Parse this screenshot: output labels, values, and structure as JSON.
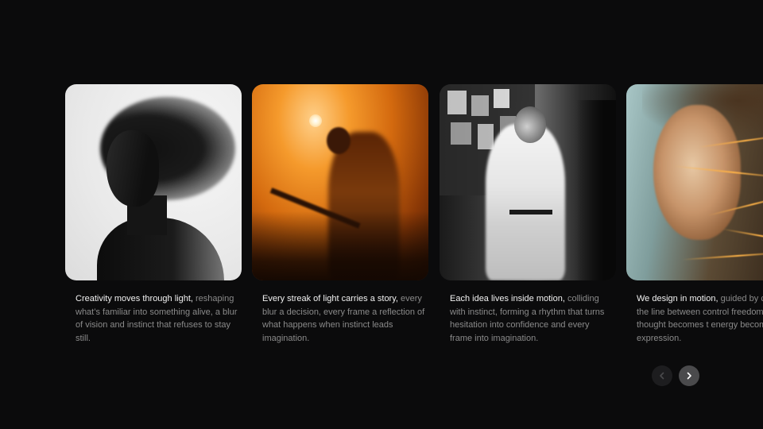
{
  "cards": [
    {
      "image_alt": "Monochrome portrait of a man with motion-blurred hair",
      "lead": "Creativity moves through light,",
      "body": " reshaping what’s familiar into something alive, a blur of vision and instinct that refuses to stay still."
    },
    {
      "image_alt": "Blurred guitarist on stage in orange light",
      "lead": "Every streak of light carries a story,",
      "body": " every blur a decision, every frame a reflection of what happens when instinct leads imagination."
    },
    {
      "image_alt": "Black and white photo of a young man in a white shirt in a cluttered room",
      "lead": "Each idea lives inside motion,",
      "body": " colliding with instinct, forming a rhythm that turns hesitation into confidence and every frame into imagination."
    },
    {
      "image_alt": "Portrait of a woman with amber light streaks",
      "lead": "We design in motion,",
      "body": " guided by c chasing the line between control freedom until thought becomes t energy becomes expression."
    }
  ],
  "navigation": {
    "prev_icon": "chevron-left-icon",
    "next_icon": "chevron-right-icon"
  },
  "colors": {
    "background": "#0b0b0c",
    "lead_text": "#f2f2f2",
    "body_text": "#8a8a8a",
    "nav_active": "#4a4a4c",
    "nav_inactive": "#1d1d1f"
  }
}
